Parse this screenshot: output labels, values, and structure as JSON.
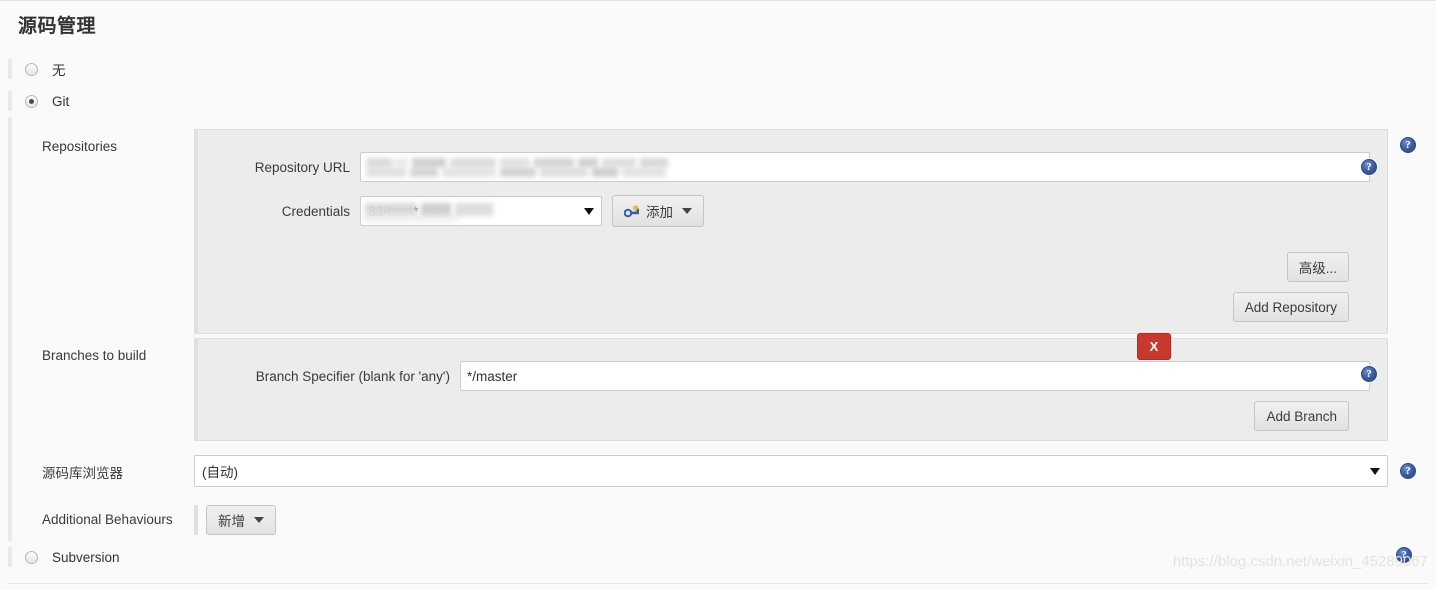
{
  "page": {
    "title": "源码管理",
    "watermark": "https://blog.csdn.net/weixin_45289067"
  },
  "scm_options": [
    {
      "label": "无",
      "checked": false
    },
    {
      "label": "Git",
      "checked": true
    },
    {
      "label": "Subversion",
      "checked": false
    }
  ],
  "git": {
    "repositories": {
      "row_label": "Repositories",
      "repository_url": {
        "label": "Repository URL",
        "value": "",
        "redacted": true
      },
      "credentials": {
        "label": "Credentials",
        "selected": "33/******",
        "redacted": true
      },
      "add_credentials_button": "添加",
      "add_credentials_icon": "key-icon",
      "advanced_button": "高级...",
      "add_repository_button": "Add Repository"
    },
    "branches": {
      "row_label": "Branches to build",
      "branch_specifier": {
        "label": "Branch Specifier (blank for 'any')",
        "value": "*/master"
      },
      "delete_button": "X",
      "add_branch_button": "Add Branch"
    },
    "repository_browser": {
      "row_label": "源码库浏览器",
      "selected": "(自动)"
    },
    "additional_behaviours": {
      "row_label": "Additional Behaviours",
      "add_button": "新增"
    }
  },
  "help_icons": {
    "repositories": "help-icon",
    "repository_url": "help-icon",
    "branches": "help-icon",
    "branch_specifier": "help-icon",
    "repository_browser": "help-icon",
    "subversion": "help-icon"
  },
  "colors": {
    "danger": "#c9382c",
    "help_blue": "#39599c",
    "panel_bg": "#ececec",
    "page_bg": "#fafafa"
  }
}
